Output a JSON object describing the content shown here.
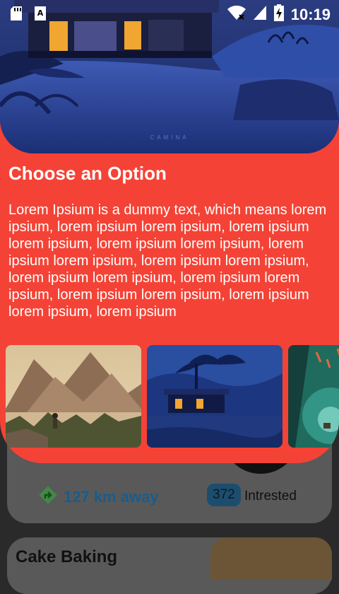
{
  "status_bar": {
    "time": "10:19",
    "icons": [
      "sd-card-icon",
      "a-notification-icon",
      "wifi-icon",
      "signal-icon",
      "battery-charging-icon"
    ]
  },
  "sheet": {
    "title": "Choose an Option",
    "body": "Lorem Ipsium is a dummy text, which means lorem ipsium, lorem ipsium lorem ipsium, lorem ipsium lorem ipsium, lorem ipsium lorem ipsium, lorem ipsium lorem ipsium, lorem ipsium lorem ipsium, lorem ipsium lorem ipsium, lorem ipsium lorem ipsium, lorem ipsium lorem ipsium, lorem ipsium lorem ipsium, lorem ipsium",
    "hero_caption": "CAMINA",
    "colors": {
      "accent": "#f44336"
    }
  },
  "cards": [
    {
      "distance": "127 km away",
      "count": "372",
      "count_label": "Intrested"
    },
    {
      "title": "Cake Baking"
    }
  ]
}
